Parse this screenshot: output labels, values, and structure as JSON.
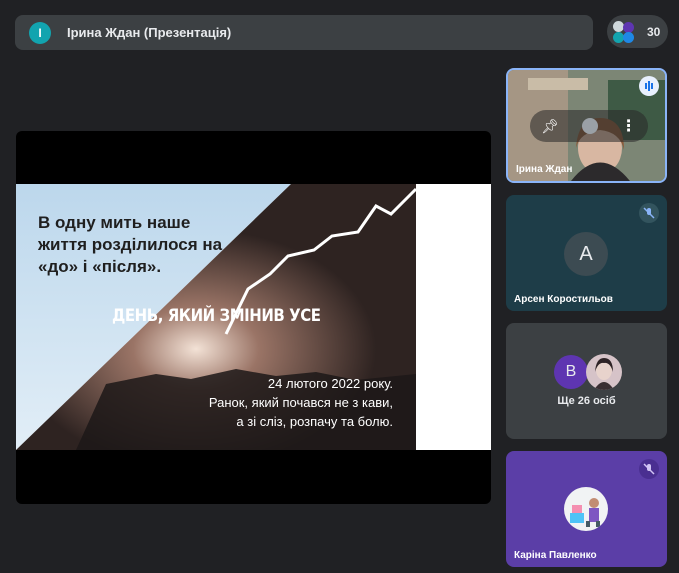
{
  "presenter": {
    "avatar_letter": "І",
    "name": "Ірина Ждан (Презентація)"
  },
  "people": {
    "count": "30"
  },
  "slide": {
    "quote_line1": "В одну мить наше",
    "quote_line2": "життя розділилося на",
    "quote_line3": "«до» і «після».",
    "headline": "ДЕНЬ, ЯКИЙ ЗМІНИВ УСЕ",
    "caption_line1": "24 лютого 2022 року.",
    "caption_line2": "Ранок, який почався не з кави,",
    "caption_line3": "а зі сліз, розпачу та болю."
  },
  "participants": [
    {
      "name": "Ірина Ждан",
      "muted": false,
      "speaking": true
    },
    {
      "name": "Арсен Коростильов",
      "avatar_letter": "A",
      "muted": true
    },
    {
      "name": "Ще 26 осіб",
      "avatar_letter": "B"
    },
    {
      "name": "Каріна Павленко",
      "muted": true
    }
  ],
  "colors": {
    "background": "#202124",
    "accent_teal": "#12a4af",
    "tile_arsen": "#1e3d48",
    "tile_karina": "#5b3ea7",
    "avatar_b": "#5e35b1"
  }
}
